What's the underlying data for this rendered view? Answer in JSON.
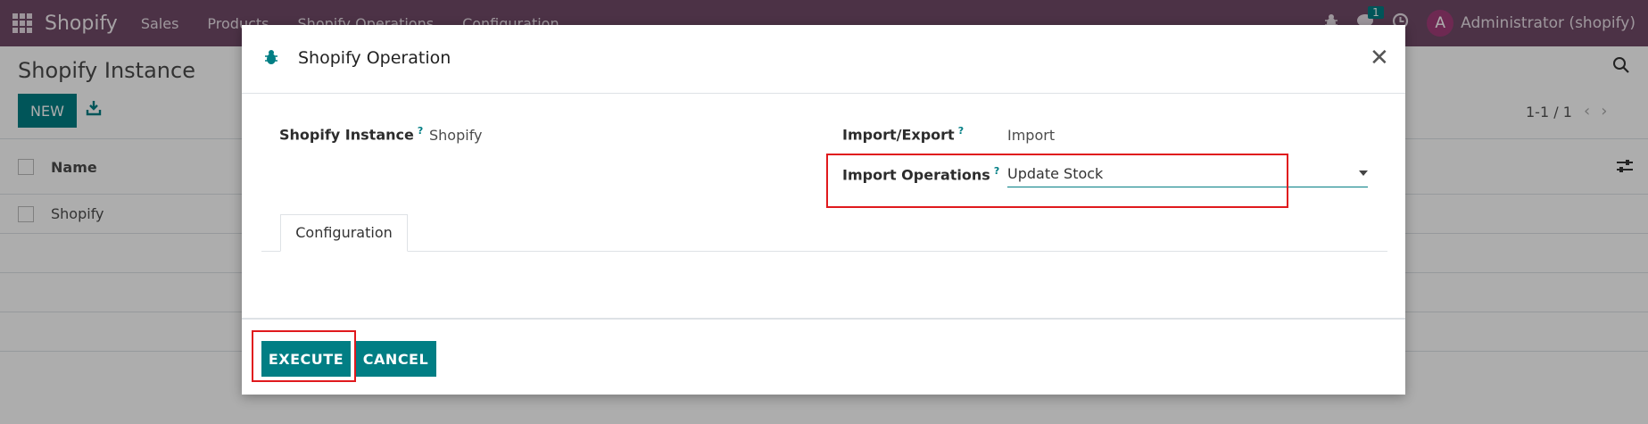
{
  "navbar": {
    "brand": "Shopify",
    "menu": [
      "Sales",
      "Products",
      "Shopify Operations",
      "Configuration"
    ],
    "chat_badge": "1",
    "user_initial": "A",
    "user_name": "Administrator (shopify)"
  },
  "control_panel": {
    "title": "Shopify Instance",
    "new_label": "NEW",
    "pager": "1-1 / 1"
  },
  "list": {
    "column_name": "Name",
    "rows": [
      "Shopify"
    ]
  },
  "modal": {
    "title": "Shopify Operation",
    "instance_label": "Shopify Instance",
    "instance_value": "Shopify",
    "help_mark": "?",
    "import_export_label": "Import/Export",
    "import_export_value": "Import",
    "import_ops_label": "Import Operations",
    "import_ops_value": "Update Stock",
    "tab_configuration": "Configuration",
    "execute_label": "EXECUTE",
    "cancel_label": "CANCEL"
  },
  "colors": {
    "navbar": "#714b67",
    "primary": "#017e84",
    "highlight": "#e0191d"
  }
}
